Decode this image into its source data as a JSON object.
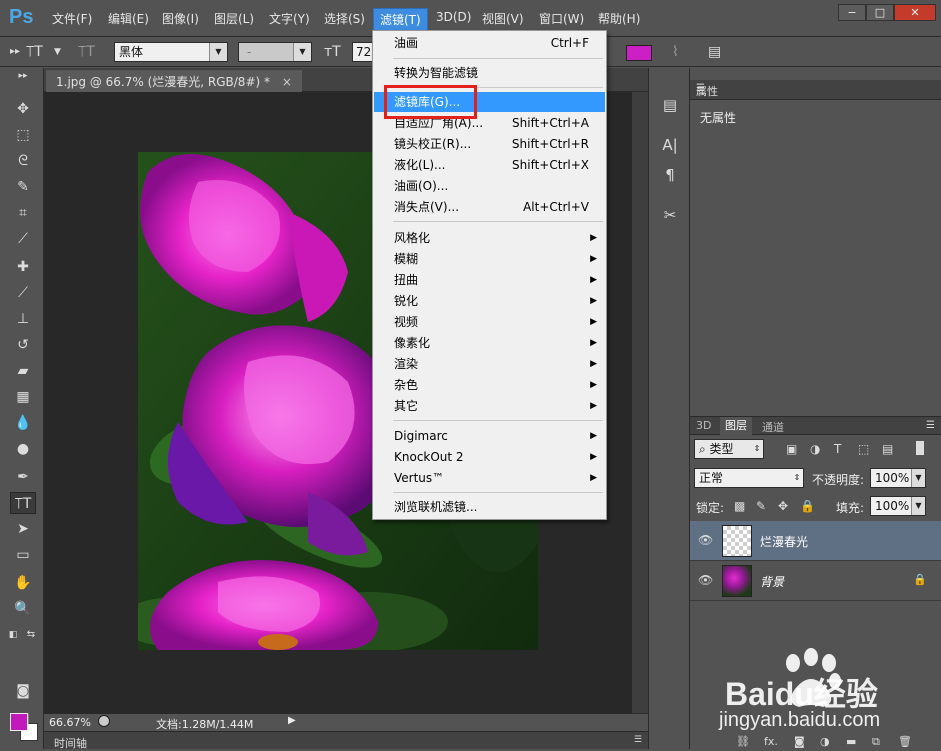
{
  "app": {
    "logo": "Ps"
  },
  "menubar": {
    "items": [
      "文件(F)",
      "编辑(E)",
      "图像(I)",
      "图层(L)",
      "文字(Y)",
      "选择(S)",
      "滤镜(T)",
      "3D(D)",
      "视图(V)",
      "窗口(W)",
      "帮助(H)"
    ],
    "active_index": 6,
    "window_buttons": [
      "−",
      "□",
      "✕"
    ]
  },
  "options": {
    "font_family": "黑体",
    "font_style": "-",
    "font_size": "72"
  },
  "document": {
    "tab_title": "1.jpg @ 66.7% (烂漫春光, RGB/8#) *",
    "tab_close": "×",
    "zoom": "66.67%",
    "doc_info": "文档:1.28M/1.44M",
    "timeline_label": "时间轴"
  },
  "filter_menu": {
    "items": [
      {
        "label": "油画",
        "shortcut": "Ctrl+F"
      },
      {
        "label": "转换为智能滤镜",
        "shortcut": ""
      },
      {
        "label": "滤镜库(G)...",
        "shortcut": ""
      },
      {
        "label": "自适应广角(A)...",
        "shortcut": "Shift+Ctrl+A"
      },
      {
        "label": "镜头校正(R)...",
        "shortcut": "Shift+Ctrl+R"
      },
      {
        "label": "液化(L)...",
        "shortcut": "Shift+Ctrl+X"
      },
      {
        "label": "油画(O)...",
        "shortcut": ""
      },
      {
        "label": "消失点(V)...",
        "shortcut": "Alt+Ctrl+V"
      },
      {
        "label": "风格化"
      },
      {
        "label": "模糊"
      },
      {
        "label": "扭曲"
      },
      {
        "label": "锐化"
      },
      {
        "label": "视频"
      },
      {
        "label": "像素化"
      },
      {
        "label": "渲染"
      },
      {
        "label": "杂色"
      },
      {
        "label": "其它"
      },
      {
        "label": "Digimarc"
      },
      {
        "label": "KnockOut 2"
      },
      {
        "label": "Vertus™"
      },
      {
        "label": "浏览联机滤镜..."
      }
    ],
    "highlighted_index": 2
  },
  "properties": {
    "tab_label": "属性",
    "content": "无属性"
  },
  "layers": {
    "tabs": [
      "3D",
      "图层",
      "通道"
    ],
    "active_tab": 1,
    "filter_type": "类型",
    "blend_mode": "正常",
    "opacity_label": "不透明度:",
    "opacity_value": "100%",
    "lock_label": "锁定:",
    "fill_label": "填充:",
    "fill_value": "100%",
    "items": [
      {
        "name": "烂漫春光",
        "selected": true
      },
      {
        "name": "背景",
        "selected": false
      }
    ]
  },
  "watermark": {
    "brand": "Baidu经验",
    "url": "jingyan.baidu.com"
  },
  "colors": {
    "accent": "#3399ff",
    "foreground": "#c21aba",
    "background": "#ffffff",
    "highlight_box": "#e3201b"
  }
}
